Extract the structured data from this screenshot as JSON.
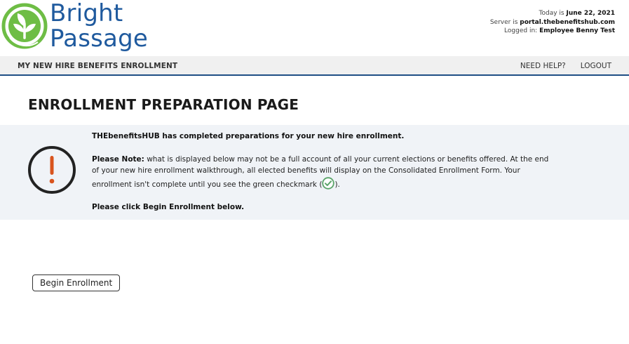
{
  "brand": {
    "line1": "Bright",
    "line2": "Passage",
    "color": "#1f5a9e",
    "leaf_color": "#6ebd45"
  },
  "status": {
    "today_label": "Today is",
    "today_value": "June 22, 2021",
    "server_label": "Server is",
    "server_value": "portal.thebenefitshub.com",
    "logged_label": "Logged in:",
    "logged_value": "Employee Benny Test"
  },
  "nav": {
    "title": "MY NEW HIRE BENEFITS ENROLLMENT",
    "help_label": "NEED HELP?",
    "logout_label": "LOGOUT"
  },
  "page": {
    "title": "ENROLLMENT PREPARATION PAGE"
  },
  "notice": {
    "headline": "THEbenefitsHUB has completed preparations for your new hire enrollment.",
    "note_label": "Please Note:",
    "note_text_before": " what is displayed below may not be a full account of all your current elections or benefits offered. At the end of your new hire enrollment walkthrough, all elected benefits will display on the Consolidated Enrollment Form. Your enrollment isn't complete until you see the green checkmark (",
    "note_text_after": ").",
    "instruction": "Please click Begin Enrollment below.",
    "icon_color": "#d9541e",
    "check_color": "#5aa469"
  },
  "actions": {
    "begin_label": "Begin Enrollment"
  }
}
